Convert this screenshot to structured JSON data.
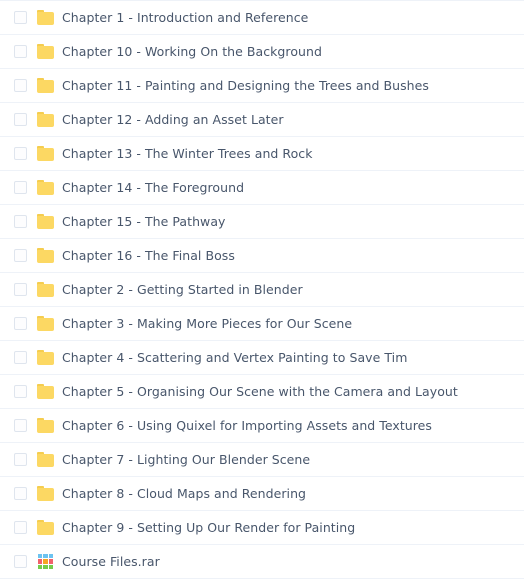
{
  "colors": {
    "row_background": "#ffffff",
    "row_separator": "#eef2f8",
    "text": "#48566b",
    "checkbox_border": "#dfe5ee",
    "folder_body": "#fcd863",
    "folder_tab": "#f5cd4f"
  },
  "file_list": {
    "rows": [
      {
        "name": "Chapter 1 - Introduction and Reference",
        "icon": "folder-icon",
        "checked": false
      },
      {
        "name": "Chapter 10 - Working On the Background",
        "icon": "folder-icon",
        "checked": false
      },
      {
        "name": "Chapter 11 - Painting and Designing the Trees and Bushes",
        "icon": "folder-icon",
        "checked": false
      },
      {
        "name": "Chapter 12 - Adding an Asset Later",
        "icon": "folder-icon",
        "checked": false
      },
      {
        "name": "Chapter 13 - The Winter Trees and Rock",
        "icon": "folder-icon",
        "checked": false
      },
      {
        "name": "Chapter 14 - The Foreground",
        "icon": "folder-icon",
        "checked": false
      },
      {
        "name": "Chapter 15 - The Pathway",
        "icon": "folder-icon",
        "checked": false
      },
      {
        "name": "Chapter 16 - The Final Boss",
        "icon": "folder-icon",
        "checked": false
      },
      {
        "name": "Chapter 2 - Getting Started in Blender",
        "icon": "folder-icon",
        "checked": false
      },
      {
        "name": "Chapter 3 - Making More Pieces for Our Scene",
        "icon": "folder-icon",
        "checked": false
      },
      {
        "name": "Chapter 4 - Scattering and Vertex Painting to Save Tim",
        "icon": "folder-icon",
        "checked": false
      },
      {
        "name": "Chapter 5 - Organising Our Scene with the Camera and Layout",
        "icon": "folder-icon",
        "checked": false
      },
      {
        "name": "Chapter 6 - Using Quixel for Importing Assets and Textures",
        "icon": "folder-icon",
        "checked": false
      },
      {
        "name": "Chapter 7 - Lighting Our Blender Scene",
        "icon": "folder-icon",
        "checked": false
      },
      {
        "name": "Chapter 8 - Cloud Maps and Rendering",
        "icon": "folder-icon",
        "checked": false
      },
      {
        "name": "Chapter 9 - Setting Up Our Render for Painting",
        "icon": "folder-icon",
        "checked": false
      },
      {
        "name": "Course Files.rar",
        "icon": "rar-archive-icon",
        "checked": false
      }
    ]
  },
  "rar_icon_tiles": [
    "#6cc3f0",
    "#6cc3f0",
    "#6cc3f0",
    "#f2616b",
    "#f5a623",
    "#f2616b",
    "#74cc4b",
    "#74cc4b",
    "#74cc4b"
  ]
}
